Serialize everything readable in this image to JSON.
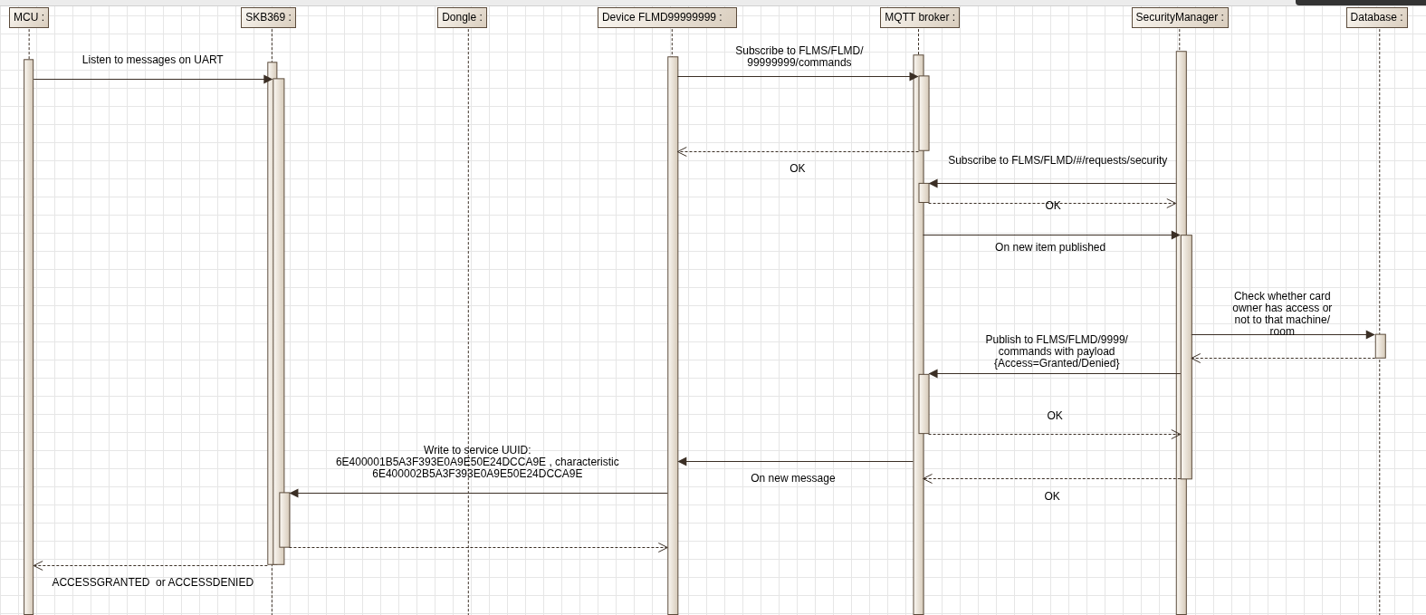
{
  "participants": [
    {
      "name": "MCU :"
    },
    {
      "name": "SKB369 :"
    },
    {
      "name": "Dongle :"
    },
    {
      "name": "Device FLMD99999999 :"
    },
    {
      "name": "MQTT broker :"
    },
    {
      "name": "SecurityManager :"
    },
    {
      "name": "Database :"
    }
  ],
  "messages": [
    {
      "kind": "call",
      "label": "Listen to messages on UART"
    },
    {
      "kind": "call",
      "label": "Subscribe to FLMS/FLMD/\n99999999/commands"
    },
    {
      "kind": "return",
      "label": "OK"
    },
    {
      "kind": "call",
      "label": "Subscribe to FLMS/FLMD/#/requests/security"
    },
    {
      "kind": "return",
      "label": "OK"
    },
    {
      "kind": "call",
      "label": "On new item published"
    },
    {
      "kind": "call",
      "label": "Check whether card\nowner has access or\nnot to that machine/\nroom"
    },
    {
      "kind": "return"
    },
    {
      "kind": "call",
      "label": "Publish to FLMS/FLMD/9999/\ncommands with payload\n{Access=Granted/Denied}"
    },
    {
      "kind": "return",
      "label": "OK"
    },
    {
      "kind": "call",
      "label": "On new message"
    },
    {
      "kind": "return",
      "label": "OK"
    },
    {
      "kind": "call",
      "label": "Write to service UUID:\n6E400001B5A3F393E0A9E50E24DCCA9E , characteristic\n6E400002B5A3F393E0A9E50E24DCCA9E"
    },
    {
      "kind": "return"
    },
    {
      "kind": "return",
      "label": "ACCESSGRANTED  or ACCESSDENIED"
    }
  ]
}
